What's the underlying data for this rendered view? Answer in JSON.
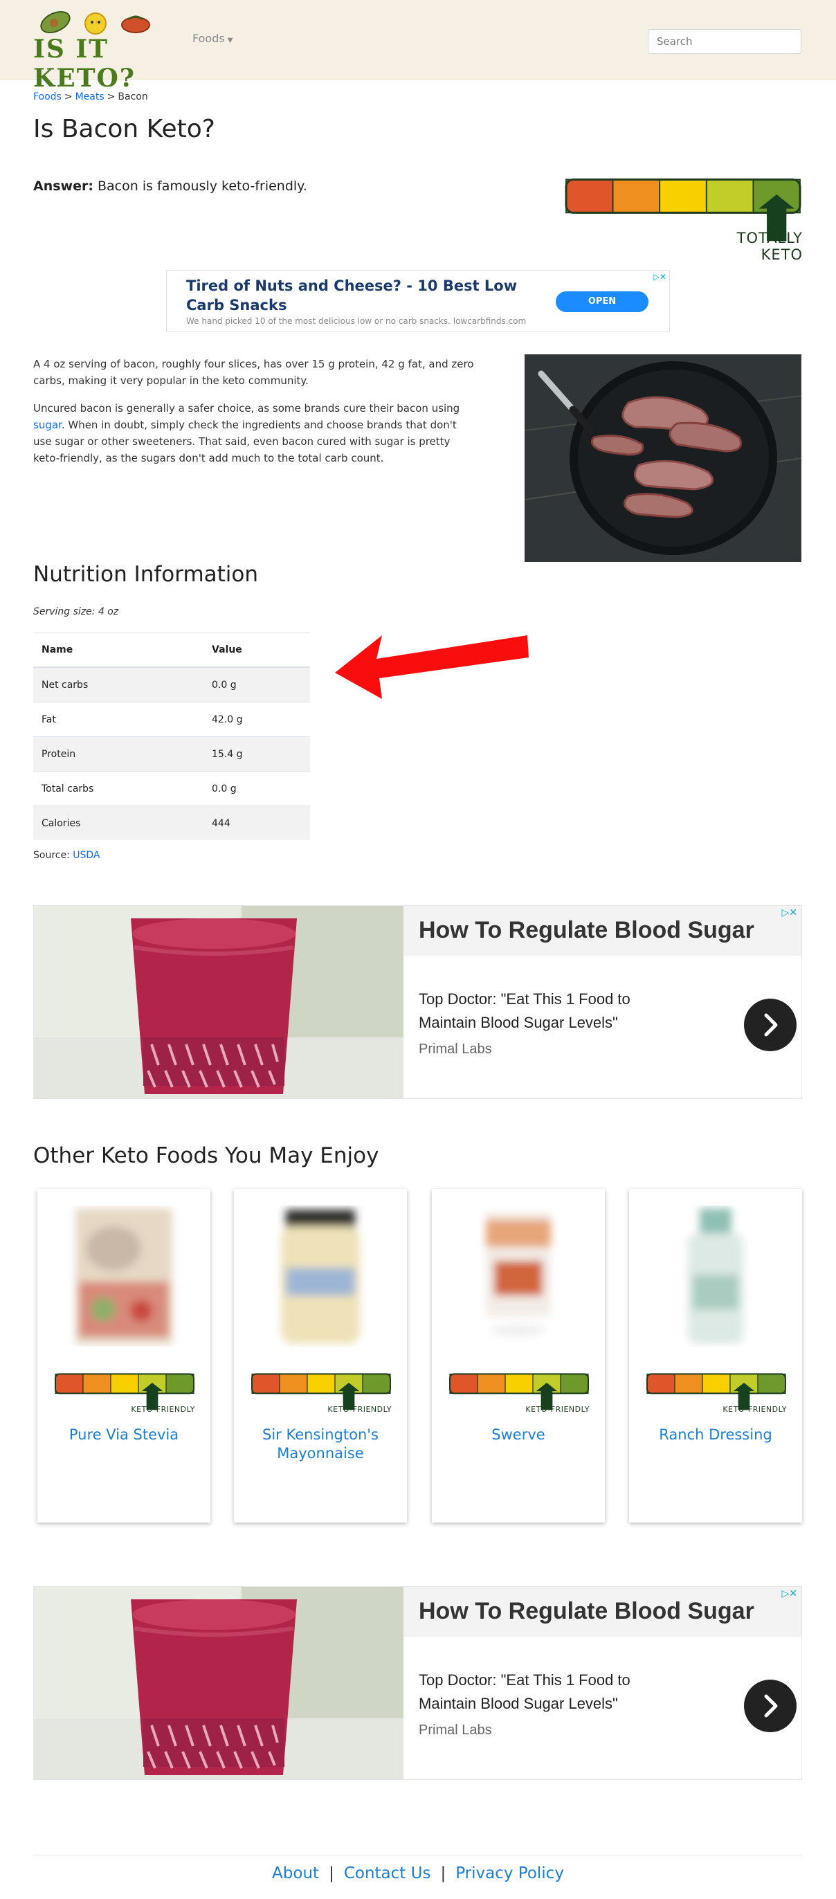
{
  "header": {
    "logo_text": "IS IT KETO?",
    "foods_menu_label": "Foods",
    "search_placeholder": "Search"
  },
  "breadcrumb": {
    "items": [
      "Foods",
      "Meats"
    ],
    "separator": ">",
    "current": "Bacon"
  },
  "page_title": "Is Bacon Keto?",
  "answer": {
    "label": "Answer:",
    "text": "Bacon is famously keto-friendly."
  },
  "keto_meter": {
    "label": "TOTALLY KETO",
    "segments": [
      "#e0552a",
      "#ef8f1f",
      "#f8d000",
      "#c2cd2a",
      "#6e9a2b"
    ],
    "selected_segment": 5,
    "outline_color": "#1e3b1e"
  },
  "top_ad": {
    "headline": "Tired of Nuts and Cheese? - 10 Best Low Carb Snacks",
    "subtext": "We hand picked 10 of the most delicious low or no carb snacks. lowcarbfinds.com",
    "button": "OPEN",
    "choices_icon": "▷✕"
  },
  "body": {
    "p1": "A 4 oz serving of bacon, roughly four slices, has over 15 g protein, 42 g fat, and zero carbs, making it very popular in the keto community.",
    "p2_before": "Uncured bacon is generally a safer choice, as some brands cure their bacon using ",
    "p2_link": "sugar",
    "p2_after": ". When in doubt, simply check the ingredients and choose brands that don't use sugar or other sweeteners. That said, even bacon cured with sugar is pretty keto-friendly, as the sugars don't add much to the total carb count."
  },
  "nutrition": {
    "heading": "Nutrition Information",
    "serving": "Serving size: 4 oz",
    "columns": [
      "Name",
      "Value"
    ],
    "rows": [
      {
        "name": "Net carbs",
        "value": "0.0 g"
      },
      {
        "name": "Fat",
        "value": "42.0 g"
      },
      {
        "name": "Protein",
        "value": "15.4 g"
      },
      {
        "name": "Total carbs",
        "value": "0.0 g"
      },
      {
        "name": "Calories",
        "value": "444"
      }
    ],
    "source_label": "Source:",
    "source_link": "USDA"
  },
  "big_ad": {
    "headline": "How To Regulate Blood Sugar",
    "text": "Top Doctor: \"Eat This 1 Food to Maintain Blood Sugar Levels\"",
    "advertiser": "Primal Labs",
    "choices_icon": "▷✕"
  },
  "related": {
    "heading": "Other Keto Foods You May Enjoy",
    "meter_label": "KETO-FRIENDLY",
    "selected_segment": 4,
    "items": [
      {
        "name": "Pure Via Stevia"
      },
      {
        "name": "Sir Kensington's Mayonnaise"
      },
      {
        "name": "Swerve"
      },
      {
        "name": "Ranch Dressing"
      }
    ]
  },
  "footer": {
    "links": [
      "About",
      "Contact Us",
      "Privacy Policy"
    ],
    "separator": "|"
  }
}
